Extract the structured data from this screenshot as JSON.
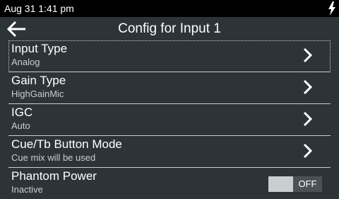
{
  "status_bar": {
    "time": "Aug 31 1:41 pm"
  },
  "header": {
    "title": "Config for Input 1"
  },
  "rows": [
    {
      "label": "Input Type",
      "value": "Analog"
    },
    {
      "label": "Gain Type",
      "value": "HighGainMic"
    },
    {
      "label": "IGC",
      "value": "Auto"
    },
    {
      "label": "Cue/Tb Button Mode",
      "value": "Cue mix will be used"
    },
    {
      "label": "Phantom Power",
      "value": "Inactive",
      "toggle": "OFF"
    }
  ],
  "icons": {
    "back": "back-arrow-icon",
    "chevron": "chevron-right-icon",
    "charging": "charging-bolt-icon"
  },
  "colors": {
    "background": "#2d3438",
    "status_bar": "#000000",
    "divider": "#c8cdd0",
    "secondary_text": "#c7ced2"
  }
}
